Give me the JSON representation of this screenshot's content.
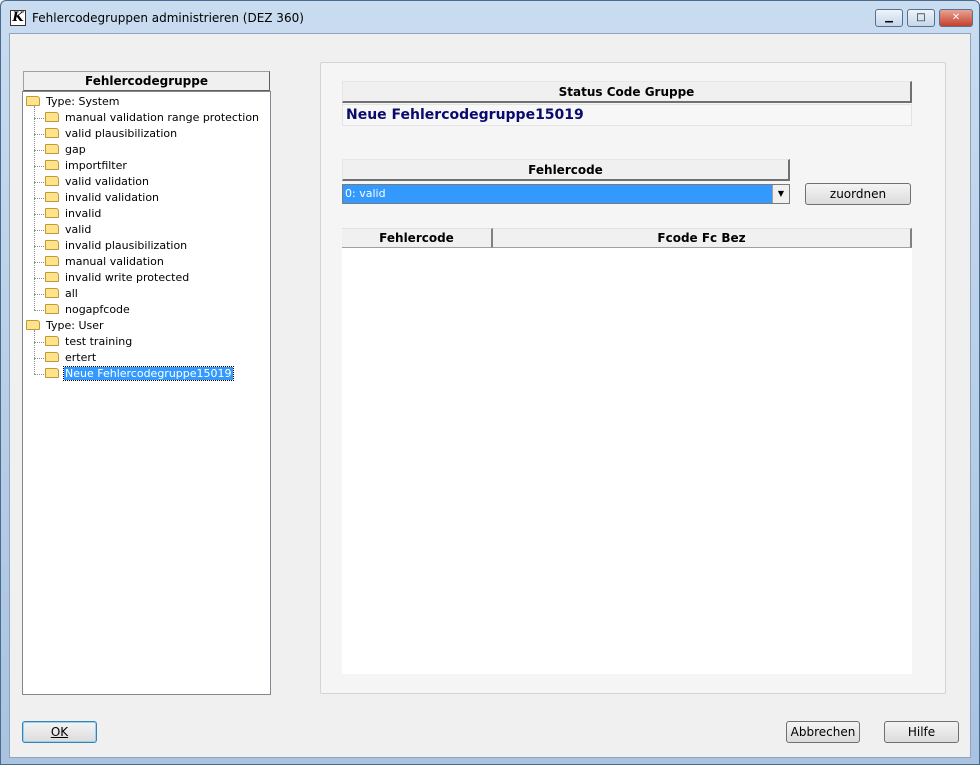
{
  "window": {
    "title": "Fehlercodegruppen administrieren (DEZ 360)",
    "icon": "K",
    "controls": {
      "minimize": "▁",
      "maximize": "□",
      "close": "✕"
    }
  },
  "tree": {
    "header": "Fehlercodegruppe",
    "groups": [
      {
        "label": "Type: System",
        "items": [
          "manual validation range protection",
          "valid plausibilization",
          "gap",
          "importfilter",
          "valid validation",
          "invalid validation",
          "invalid",
          "valid",
          "invalid plausibilization",
          "manual validation",
          "invalid write protected",
          "all",
          "nogapfcode"
        ]
      },
      {
        "label": "Type: User",
        "items": [
          "test training",
          "ertert",
          "Neue Fehlercodegruppe15019"
        ]
      }
    ],
    "selected": "Neue Fehlercodegruppe15019"
  },
  "status": {
    "header": "Status Code Gruppe",
    "value": "Neue Fehlercodegruppe15019"
  },
  "fehlercode": {
    "header": "Fehlercode",
    "selected_value": "0: valid",
    "assign_button": "zuordnen"
  },
  "grid": {
    "columns": [
      "Fehlercode",
      "Fcode Fc Bez"
    ],
    "rows": []
  },
  "footer": {
    "ok": "OK",
    "cancel": "Abbrechen",
    "help": "Hilfe"
  }
}
